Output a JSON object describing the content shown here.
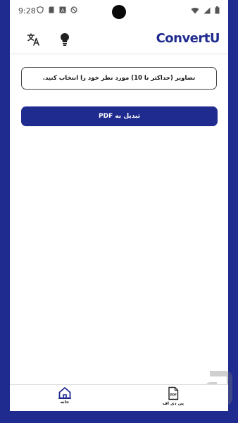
{
  "status_bar": {
    "time": "9:28",
    "left_icons": [
      "shield-icon",
      "sd-card-icon",
      "a-icon",
      "no-sim-icon"
    ],
    "right_icons": [
      "wifi-icon",
      "signal-icon",
      "battery-icon"
    ]
  },
  "header": {
    "logo": "ConvertU",
    "buttons": [
      "translate-icon",
      "lightbulb-icon"
    ]
  },
  "main": {
    "info_text": "تصاویر (حداکثر تا 10) مورد نظر خود را انتخاب کنید.",
    "convert_button": "تبدیل به PDF"
  },
  "bottom_nav": {
    "items": [
      {
        "label": "خانه",
        "icon": "home-icon"
      },
      {
        "label": "پی دی اف",
        "icon": "pdf-file-icon"
      }
    ]
  },
  "colors": {
    "brand": "#1f2b8f",
    "background": "#ffffff"
  }
}
